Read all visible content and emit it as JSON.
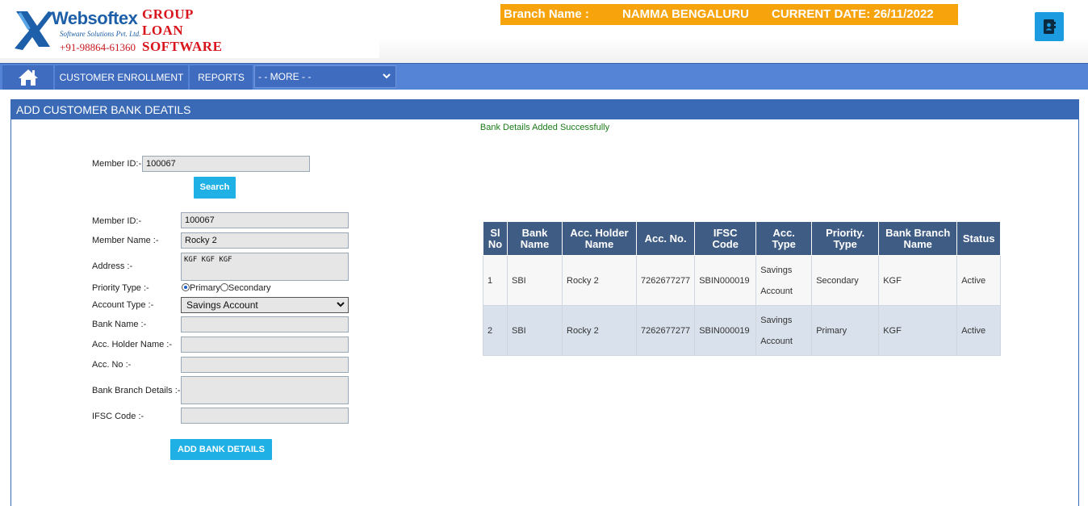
{
  "brand": {
    "name": "Websoftex",
    "tagline": "Software Solutions Pvt. Ltd.",
    "phone": "+91-98864-61360",
    "product_line1": "GROUP",
    "product_line2": "LOAN",
    "product_line3": "SOFTWARE"
  },
  "header": {
    "branch_label": "Branch Name :",
    "branch_value": "NAMMA BENGALURU",
    "current_date": "CURRENT DATE: 26/11/2022",
    "profile_icon": "contact-book-icon"
  },
  "nav": {
    "home_icon": "home-icon",
    "customer_enrollment": "CUSTOMER ENROLLMENT",
    "reports": "REPORTS",
    "more_select": "- - MORE - -"
  },
  "panel": {
    "title": "ADD CUSTOMER BANK DEATILS",
    "success_message": "Bank Details Added Successfully"
  },
  "search": {
    "member_id_label": "Member ID:-",
    "member_id_value": "100067",
    "search_button": "Search"
  },
  "form": {
    "member_id_label": "Member ID:-",
    "member_id_value": "100067",
    "member_name_label": "Member Name :-",
    "member_name_value": "Rocky 2",
    "address_label": "Address :-",
    "address_value": "KGF KGF KGF",
    "priority_type_label": "Priority Type :-",
    "priority_primary": "Primary",
    "priority_secondary": "Secondary",
    "priority_selected": "Primary",
    "account_type_label": "Account Type :-",
    "account_type_value": "Savings Account",
    "bank_name_label": "Bank Name :-",
    "bank_name_value": "",
    "holder_name_label": "Acc. Holder Name :-",
    "holder_name_value": "",
    "acc_no_label": "Acc. No :-",
    "acc_no_value": "",
    "branch_details_label": "Bank Branch Details :-",
    "branch_details_value": "",
    "ifsc_label": "IFSC Code :-",
    "ifsc_value": "",
    "submit_button": "ADD BANK DETAILS"
  },
  "table": {
    "headers": [
      "Sl No",
      "Bank Name",
      "Acc. Holder Name",
      "Acc. No.",
      "IFSC Code",
      "Acc. Type",
      "Priority. Type",
      "Bank Branch Name",
      "Status"
    ],
    "rows": [
      [
        "1",
        "SBI",
        "Rocky 2",
        "7262677277",
        "SBIN000019",
        "Savings Account",
        "Secondary",
        "KGF",
        "Active"
      ],
      [
        "2",
        "SBI",
        "Rocky 2",
        "7262677277",
        "SBIN000019",
        "Savings Account",
        "Primary",
        "KGF",
        "Active"
      ]
    ]
  },
  "colors": {
    "accent_orange": "#f6a30c",
    "nav_blue": "#5584d6",
    "panel_blue": "#3a6ab5",
    "table_header": "#3f5c84",
    "button_cyan": "#1fb1e6",
    "success_green": "#1a7b18"
  }
}
